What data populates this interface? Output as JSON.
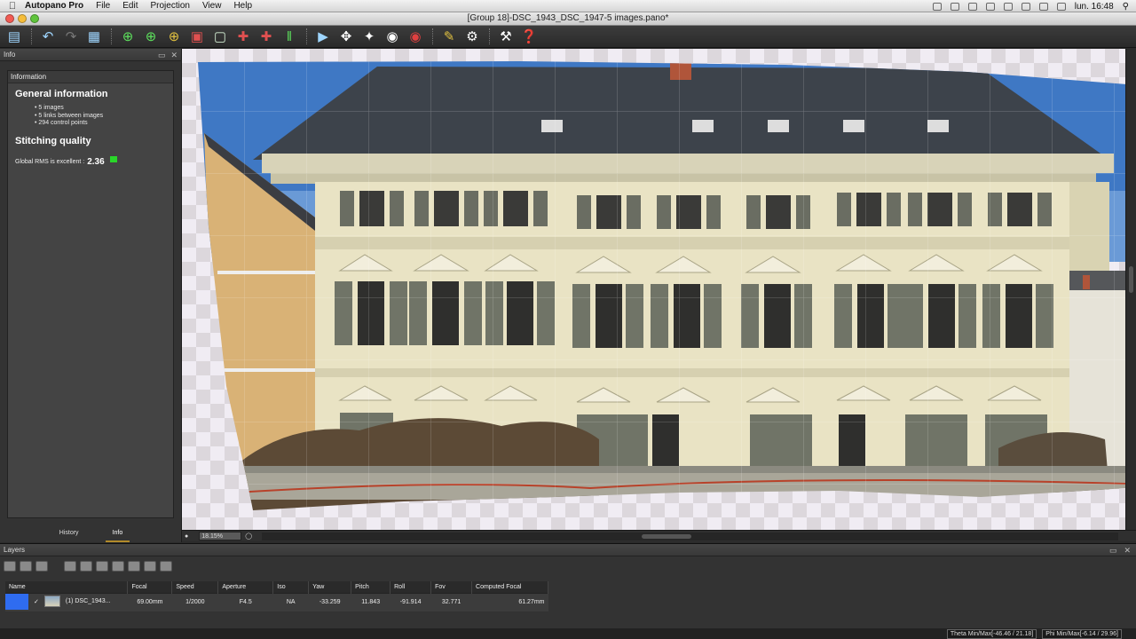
{
  "menubar": {
    "app_name": "Autopano Pro",
    "items": [
      "File",
      "Edit",
      "Projection",
      "View",
      "Help"
    ],
    "clock": "lun. 16:48"
  },
  "window": {
    "title": "[Group 18]-DSC_1943_DSC_1947-5 images.pano*"
  },
  "info_panel": {
    "title": "Info",
    "section_label": "Information",
    "general_title": "General information",
    "general_items": [
      "5 images",
      "5 links between images",
      "294 control points"
    ],
    "stitching_title": "Stitching quality",
    "rms_label": "Global RMS is excellent :",
    "rms_value": "2.36",
    "tabs": [
      "History",
      "Info"
    ],
    "active_tab": "Info"
  },
  "view": {
    "zoom": "18.15%"
  },
  "layers": {
    "title": "Layers",
    "columns": [
      "Name",
      "Focal",
      "Speed",
      "Aperture",
      "Iso",
      "Yaw",
      "Pitch",
      "Roll",
      "Fov",
      "Computed Focal"
    ],
    "rows": [
      {
        "name": "(1) DSC_1943...",
        "focal": "69.00mm",
        "speed": "1/2000",
        "aperture": "F4.5",
        "iso": "NA",
        "yaw": "-33.259",
        "pitch": "11.843",
        "roll": "-91.914",
        "fov": "32.771",
        "computed_focal": "61.27mm",
        "color": "#2f6cf0"
      }
    ]
  },
  "footer": {
    "theta": "Theta Min/Max[-46.46 / 21.18]",
    "phi": "Phi Min/Max[-6.14 / 29.96]"
  },
  "colors": {
    "accent_tab": "#b28a2a",
    "rms_flag": "#29d629"
  }
}
